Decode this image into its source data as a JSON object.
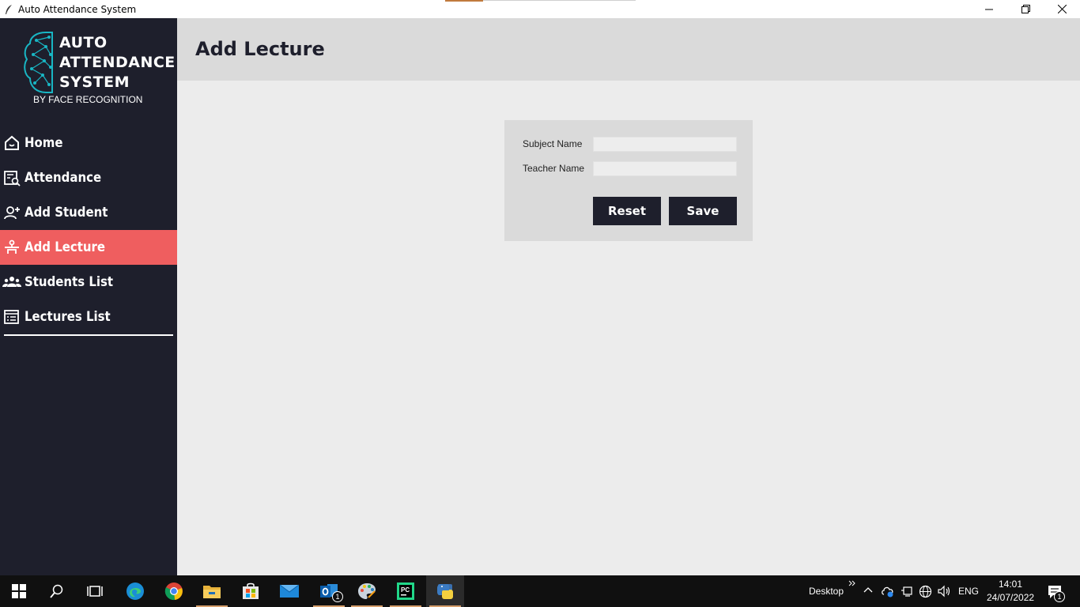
{
  "window": {
    "title": "Auto Attendance System"
  },
  "logo": {
    "line1": "AUTO",
    "line2": "ATTENDANCE",
    "line3": "SYSTEM",
    "tagline": "BY FACE RECOGNITION"
  },
  "sidebar": {
    "items": [
      {
        "label": "Home",
        "icon": "home-icon",
        "active": false
      },
      {
        "label": "Attendance",
        "icon": "attendance-search-icon",
        "active": false
      },
      {
        "label": "Add Student",
        "icon": "add-user-icon",
        "active": false
      },
      {
        "label": "Add Lecture",
        "icon": "lecturer-icon",
        "active": true
      },
      {
        "label": "Students List",
        "icon": "group-icon",
        "active": false
      },
      {
        "label": "Lectures List",
        "icon": "list-icon",
        "active": false
      }
    ]
  },
  "header": {
    "title": "Add Lecture"
  },
  "form": {
    "subject_label": "Subject Name",
    "subject_value": "",
    "teacher_label": "Teacher Name",
    "teacher_value": "",
    "reset_label": "Reset",
    "save_label": "Save"
  },
  "taskbar": {
    "desktop_label": "Desktop",
    "language": "ENG",
    "time": "14:01",
    "date": "24/07/2022",
    "notification_count": "1",
    "outlook_badge": "1"
  },
  "colors": {
    "sidebar_bg": "#1e1f2c",
    "accent": "#ef5e5f",
    "header_bg": "#dadada",
    "content_bg": "#ececec",
    "logo_teal": "#19b6c4"
  }
}
